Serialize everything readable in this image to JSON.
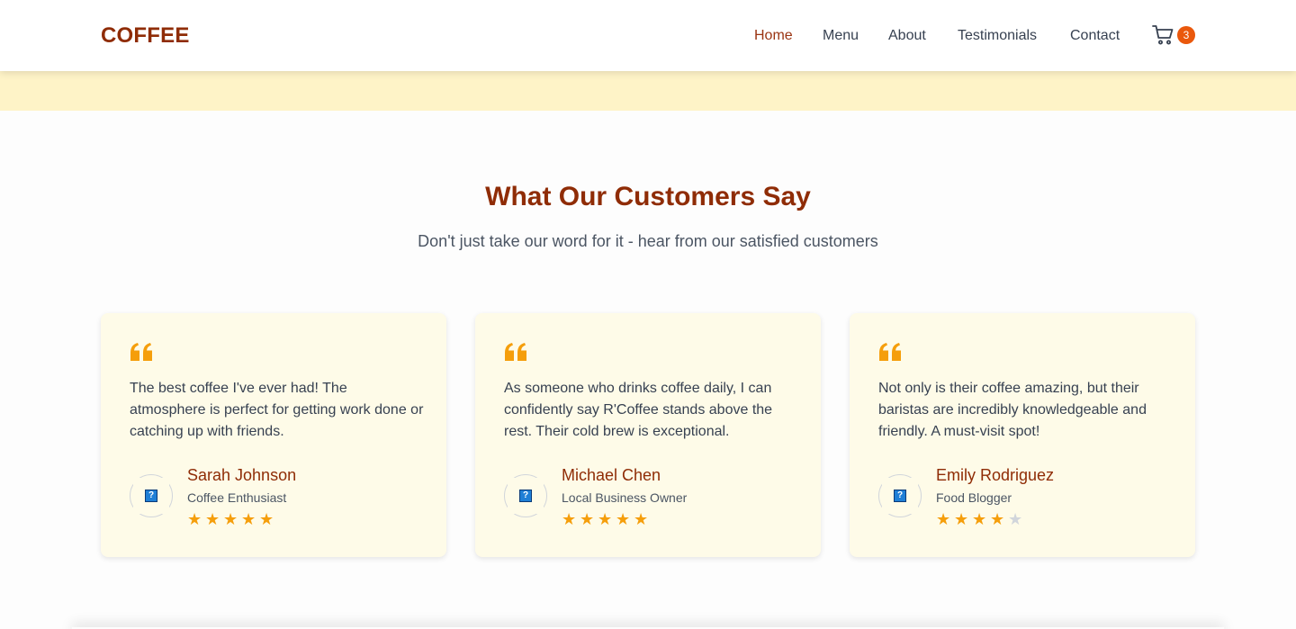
{
  "brand": {
    "logo": "COFFEE",
    "accent": "#8f2c06",
    "highlight": "#f59e0b"
  },
  "nav": {
    "items": [
      {
        "label": "Home",
        "active": true
      },
      {
        "label": "Menu",
        "active": false
      },
      {
        "label": "About",
        "active": false
      },
      {
        "label": "Testimonials",
        "active": false
      },
      {
        "label": "Contact",
        "active": false
      }
    ],
    "cart": {
      "icon": "cart-icon",
      "count": "3"
    }
  },
  "testimonials": {
    "title": "What Our Customers Say",
    "subtitle": "Don't just take our word for it - hear from our satisfied customers",
    "items": [
      {
        "text": "The best coffee I've ever had! The atmosphere is perfect for getting work done or catching up with friends.",
        "name": "Sarah Johnson",
        "role": "Coffee Enthusiast",
        "rating": 5
      },
      {
        "text": "As someone who drinks coffee daily, I can confidently say R'Coffee stands above the rest. Their cold brew is exceptional.",
        "name": "Michael Chen",
        "role": "Local Business Owner",
        "rating": 5
      },
      {
        "text": "Not only is their coffee amazing, but their baristas are incredibly knowledgeable and friendly. A must-visit spot!",
        "name": "Emily Rodriguez",
        "role": "Food Blogger",
        "rating": 4
      }
    ]
  }
}
